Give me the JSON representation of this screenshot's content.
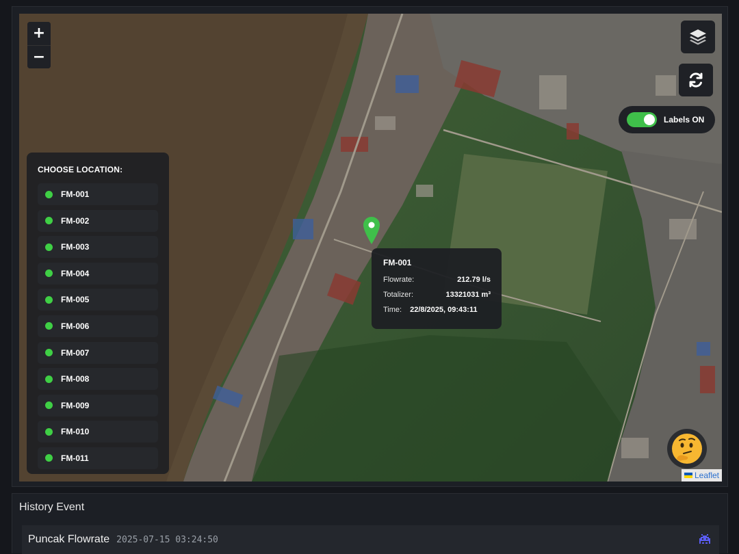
{
  "map": {
    "zoom_in_label": "+",
    "zoom_out_label": "−",
    "layers_icon": "layers-icon",
    "refresh_icon": "refresh-icon",
    "labels_toggle": {
      "label": "Labels ON",
      "on": true
    },
    "attribution": "Leaflet"
  },
  "location_panel": {
    "title": "CHOOSE LOCATION:",
    "items": [
      {
        "label": "FM-001",
        "status_color": "#3fcf45"
      },
      {
        "label": "FM-002",
        "status_color": "#3fcf45"
      },
      {
        "label": "FM-003",
        "status_color": "#3fcf45"
      },
      {
        "label": "FM-004",
        "status_color": "#3fcf45"
      },
      {
        "label": "FM-005",
        "status_color": "#3fcf45"
      },
      {
        "label": "FM-006",
        "status_color": "#3fcf45"
      },
      {
        "label": "FM-007",
        "status_color": "#3fcf45"
      },
      {
        "label": "FM-008",
        "status_color": "#3fcf45"
      },
      {
        "label": "FM-009",
        "status_color": "#3fcf45"
      },
      {
        "label": "FM-010",
        "status_color": "#3fcf45"
      },
      {
        "label": "FM-011",
        "status_color": "#3fcf45"
      }
    ]
  },
  "popup": {
    "title": "FM-001",
    "flowrate_label": "Flowrate:",
    "flowrate_value": "212.79 l/s",
    "totalizer_label": "Totalizer:",
    "totalizer_value": "13321031 m³",
    "time_label": "Time:",
    "time_value": "22/8/2025, 09:43:11"
  },
  "assistant_button": {
    "icon": "thinking-face-icon",
    "glyph": "🤔"
  },
  "history": {
    "title": "History Event",
    "events": [
      {
        "title": "Puncak Flowrate",
        "timestamp": "2025-07-15 03:24:50",
        "icon": "alien-monster-icon"
      }
    ]
  },
  "colors": {
    "status_ok": "#3fcf45",
    "marker": "#3fbf4a",
    "toggle_on": "#3fbf4a",
    "panel_bg": "#1e2024"
  }
}
